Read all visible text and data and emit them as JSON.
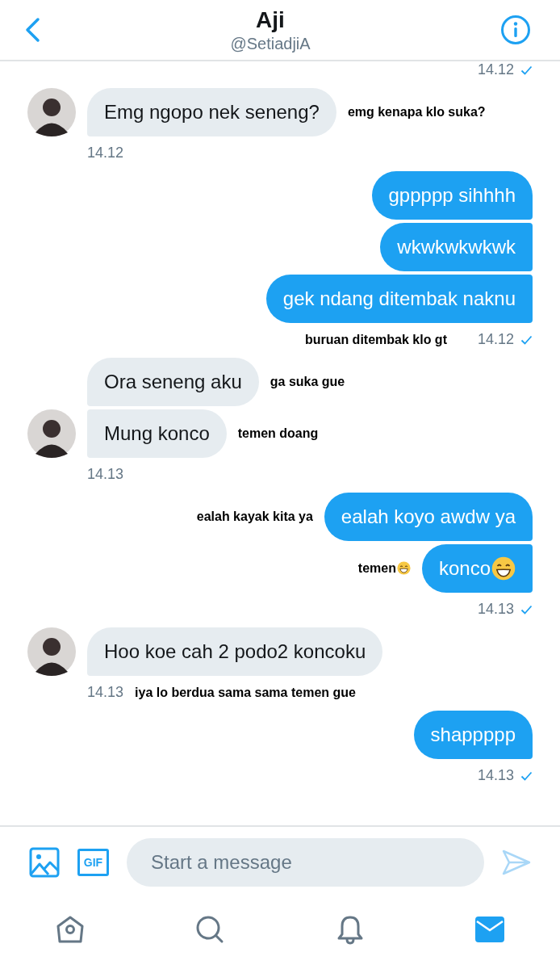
{
  "header": {
    "name": "Aji",
    "handle": "@SetiadjiA"
  },
  "messages": [
    {
      "kind": "time",
      "time": "14.12",
      "read": true
    },
    {
      "kind": "received",
      "time": "14.12",
      "bubbles": [
        {
          "kind": "plain",
          "text": "Emg ngopo nek seneng?",
          "note": "emg kenapa klo suka?"
        }
      ]
    },
    {
      "kind": "sent",
      "time": "14.12",
      "read": true,
      "time_note": "buruan ditembak klo gt",
      "bubbles": [
        {
          "kind": "plain",
          "text": "gppppp sihhhh"
        },
        {
          "kind": "plain",
          "text": "wkwkwkwkwk"
        },
        {
          "kind": "plain",
          "text": "gek ndang ditembak naknu"
        }
      ]
    },
    {
      "kind": "received",
      "time": "14.13",
      "bubbles": [
        {
          "kind": "plain",
          "text": "Ora seneng aku",
          "note": "ga suka gue"
        },
        {
          "kind": "plain",
          "text": "Mung konco",
          "note": "temen doang"
        }
      ]
    },
    {
      "kind": "sent",
      "time": "14.13",
      "read": true,
      "bubbles": [
        {
          "kind": "plain",
          "text": "ealah koyo awdw ya",
          "note": "ealah kayak kita ya"
        },
        {
          "kind": "grin",
          "text": "konco",
          "note": "temen"
        }
      ]
    },
    {
      "kind": "received",
      "time": "14.13",
      "time_note": "iya lo berdua sama sama temen gue",
      "bubbles": [
        {
          "kind": "plain",
          "text": "Hoo koe cah 2 podo2 koncoku"
        }
      ]
    },
    {
      "kind": "sent",
      "time": "14.13",
      "read": true,
      "bubbles": [
        {
          "kind": "plain",
          "text": "shappppp"
        }
      ]
    }
  ],
  "composer": {
    "gif_label": "GIF",
    "placeholder": "Start a message"
  },
  "tabs": [
    {
      "kind": "home",
      "selected": false
    },
    {
      "kind": "search",
      "selected": false
    },
    {
      "kind": "notifications",
      "selected": false
    },
    {
      "kind": "messages",
      "selected": true
    }
  ]
}
